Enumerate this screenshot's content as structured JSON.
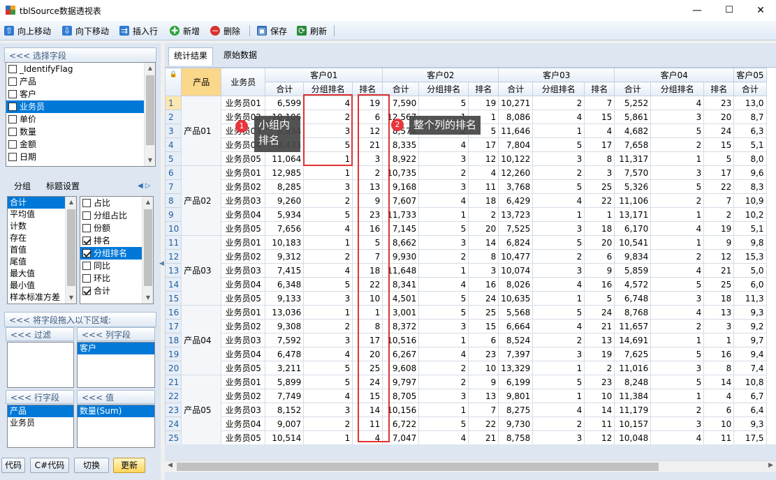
{
  "window": {
    "title": "tblSource数据透视表",
    "min": "—",
    "max": "☐",
    "close": "✕"
  },
  "toolbar": [
    {
      "label": "向上移动",
      "icon": "up-arrow-icon",
      "glyph": "⇧",
      "color": "#2f7bd2"
    },
    {
      "label": "向下移动",
      "icon": "down-arrow-icon",
      "glyph": "⇩",
      "color": "#2f7bd2"
    },
    {
      "label": "插入行",
      "icon": "insert-row-icon",
      "glyph": "⇉",
      "color": "#2f7bd2"
    },
    {
      "label": "新增",
      "icon": "add-icon",
      "glyph": "✚",
      "color": "#2aa43a"
    },
    {
      "label": "删除",
      "icon": "delete-icon",
      "glyph": "−",
      "color": "#d9322e"
    },
    {
      "label": "保存",
      "icon": "save-icon",
      "glyph": "▣",
      "color": "#2f6fb8"
    },
    {
      "label": "刷新",
      "icon": "refresh-icon",
      "glyph": "⟳",
      "color": "#2a8a3a"
    }
  ],
  "left": {
    "select_fields_header": "<<< 选择字段",
    "fields": [
      {
        "label": "_IdentifyFlag",
        "checked": false
      },
      {
        "label": "产品",
        "checked": false
      },
      {
        "label": "客户",
        "checked": false
      },
      {
        "label": "业务员",
        "checked": false,
        "selected": true
      },
      {
        "label": "单价",
        "checked": false
      },
      {
        "label": "数量",
        "checked": false
      },
      {
        "label": "金额",
        "checked": false
      },
      {
        "label": "日期",
        "checked": false
      }
    ],
    "tabs": [
      "分组",
      "标题设置"
    ],
    "stats": [
      "合计",
      "平均值",
      "计数",
      "存在",
      "首值",
      "尾值",
      "最大值",
      "最小值",
      "样本标准方差"
    ],
    "calc_options": [
      {
        "label": "占比",
        "checked": false
      },
      {
        "label": "分组占比",
        "checked": false
      },
      {
        "label": "份额",
        "checked": false
      },
      {
        "label": "排名",
        "checked": true
      },
      {
        "label": "分组排名",
        "checked": true,
        "selected": true
      },
      {
        "label": "同比",
        "checked": false
      },
      {
        "label": "环比",
        "checked": false
      },
      {
        "label": "合计",
        "checked": true
      }
    ],
    "drag_header": "<<< 将字段拖入以下区域:",
    "filter_header": "<<< 过滤",
    "column_header": "<<< 列字段",
    "column_fields": [
      "客户"
    ],
    "row_header": "<<< 行字段",
    "row_fields": [
      "产品",
      "业务员"
    ],
    "value_header": "<<< 值",
    "value_fields": [
      "数量(Sum)"
    ],
    "buttons": [
      "代码",
      "C#代码",
      "切换",
      "更新"
    ]
  },
  "tabs": [
    "统计结果",
    "原始数据"
  ],
  "grid": {
    "row_headers": [
      "产品",
      "业务员"
    ],
    "customers": [
      "客户01",
      "客户02",
      "客户03",
      "客户04",
      "客户05"
    ],
    "subcols": [
      "合计",
      "分组排名",
      "排名"
    ],
    "products": [
      "产品01",
      "产品02",
      "产品03",
      "产品04",
      "产品05"
    ],
    "rows": [
      [
        "业务员01",
        6599,
        4,
        19,
        7590,
        5,
        19,
        10271,
        2,
        7,
        5252,
        4,
        23,
        "13,0"
      ],
      [
        "业务员02",
        10106,
        2,
        6,
        12567,
        1,
        1,
        8086,
        4,
        15,
        5861,
        3,
        20,
        "8,7"
      ],
      [
        "业务员03",
        8834,
        3,
        12,
        8574,
        2,
        5,
        11646,
        1,
        4,
        4682,
        5,
        24,
        "6,3"
      ],
      [
        "业务员04",
        8433,
        5,
        21,
        8335,
        4,
        17,
        7804,
        5,
        17,
        7658,
        2,
        15,
        "5,1"
      ],
      [
        "业务员05",
        11064,
        1,
        3,
        8922,
        3,
        12,
        10122,
        3,
        8,
        11317,
        1,
        5,
        "8,0"
      ],
      [
        "业务员01",
        12985,
        1,
        2,
        10735,
        2,
        4,
        12260,
        2,
        3,
        7570,
        3,
        17,
        "9,6"
      ],
      [
        "业务员02",
        8285,
        3,
        13,
        9168,
        3,
        11,
        3768,
        5,
        25,
        5326,
        5,
        22,
        "8,3"
      ],
      [
        "业务员03",
        9260,
        2,
        9,
        7607,
        4,
        18,
        6429,
        4,
        22,
        11106,
        2,
        7,
        "10,9"
      ],
      [
        "业务员04",
        5934,
        5,
        23,
        11733,
        1,
        2,
        13723,
        1,
        1,
        13171,
        1,
        2,
        "10,2"
      ],
      [
        "业务员05",
        7656,
        4,
        16,
        7145,
        5,
        20,
        7525,
        3,
        18,
        6170,
        4,
        19,
        "5,1"
      ],
      [
        "业务员01",
        10183,
        1,
        5,
        8662,
        3,
        14,
        6824,
        5,
        20,
        10541,
        1,
        9,
        "9,8"
      ],
      [
        "业务员02",
        9312,
        2,
        7,
        9930,
        2,
        8,
        10477,
        2,
        6,
        9834,
        2,
        12,
        "15,3"
      ],
      [
        "业务员03",
        7415,
        4,
        18,
        11648,
        1,
        3,
        10074,
        3,
        9,
        5859,
        4,
        21,
        "5,0"
      ],
      [
        "业务员04",
        6348,
        5,
        22,
        8341,
        4,
        16,
        8026,
        4,
        16,
        4572,
        5,
        25,
        "6,0"
      ],
      [
        "业务员05",
        9133,
        3,
        10,
        4501,
        5,
        24,
        10635,
        1,
        5,
        6748,
        3,
        18,
        "11,3"
      ],
      [
        "业务员01",
        13036,
        1,
        1,
        3001,
        5,
        25,
        5568,
        5,
        24,
        8768,
        4,
        13,
        "9,3"
      ],
      [
        "业务员02",
        9308,
        2,
        8,
        8372,
        3,
        15,
        6664,
        4,
        21,
        11657,
        2,
        3,
        "9,2"
      ],
      [
        "业务员03",
        7592,
        3,
        17,
        10516,
        1,
        6,
        8524,
        2,
        13,
        14691,
        1,
        1,
        "9,7"
      ],
      [
        "业务员04",
        6478,
        4,
        20,
        6267,
        4,
        23,
        7397,
        3,
        19,
        7625,
        5,
        16,
        "9,4"
      ],
      [
        "业务员05",
        3211,
        5,
        25,
        9608,
        2,
        10,
        13329,
        1,
        2,
        11016,
        3,
        8,
        "7,4"
      ],
      [
        "业务员01",
        5899,
        5,
        24,
        9797,
        2,
        9,
        6199,
        5,
        23,
        8248,
        5,
        14,
        "10,8"
      ],
      [
        "业务员02",
        7749,
        4,
        15,
        8705,
        3,
        13,
        9801,
        1,
        10,
        11384,
        1,
        4,
        "6,7"
      ],
      [
        "业务员03",
        8152,
        3,
        14,
        10156,
        1,
        7,
        8275,
        4,
        14,
        11179,
        2,
        6,
        "6,4"
      ],
      [
        "业务员04",
        9007,
        2,
        11,
        6722,
        5,
        22,
        9730,
        2,
        11,
        10157,
        3,
        10,
        "9,3"
      ],
      [
        "业务员05",
        10514,
        1,
        4,
        7047,
        4,
        21,
        8758,
        3,
        12,
        10048,
        4,
        11,
        "17,5"
      ]
    ]
  },
  "annotations": [
    {
      "number": "1",
      "text": "小组内\n排名"
    },
    {
      "number": "2",
      "text": "整个列的排名"
    }
  ]
}
